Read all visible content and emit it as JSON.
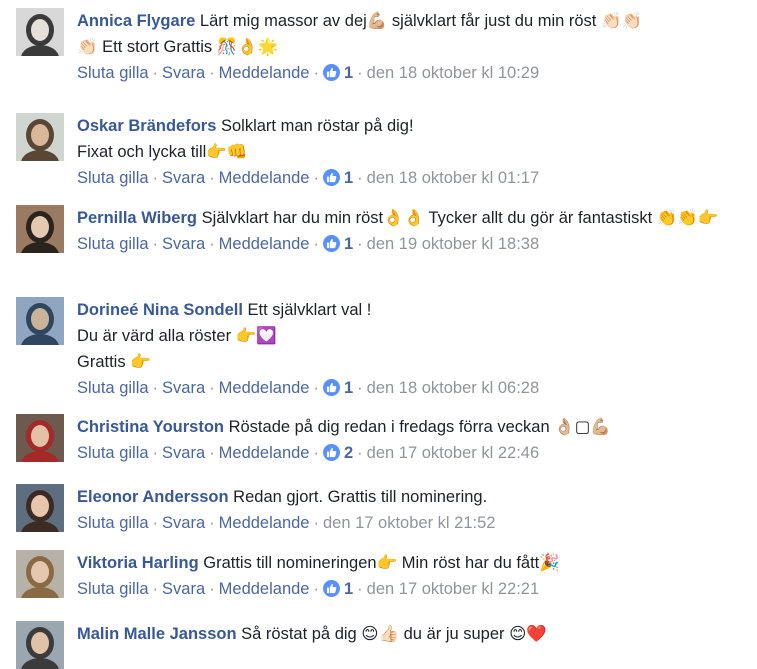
{
  "comments": [
    {
      "author": "Annica Flygare",
      "text": "Lärt mig massor av dej💪🏼 självklart får just du min röst 👏🏻👏🏻\n👏🏻 Ett stort Grattis 🎊👌🌟",
      "actions": {
        "unlike": "Sluta gilla",
        "reply": "Svara",
        "message": "Meddelande"
      },
      "likes": "1",
      "timestamp": "den 18 oktober kl 10:29",
      "avatar_colors": [
        "#d8d8d8",
        "#3a3a3a",
        "#e7e0d8"
      ]
    },
    {
      "author": "Oskar Brändefors",
      "text": "Solklart man röstar på dig!\nFixat och lycka till👉👊",
      "actions": {
        "unlike": "Sluta gilla",
        "reply": "Svara",
        "message": "Meddelande"
      },
      "likes": "1",
      "timestamp": "den 18 oktober kl 01:17",
      "avatar_colors": [
        "#cfd6cf",
        "#5a4634",
        "#d9b79a"
      ]
    },
    {
      "author": "Pernilla Wiberg",
      "text": "Självklart har du min röst👌👌 Tycker allt du gör är fantastiskt 👏👏👉",
      "actions": {
        "unlike": "Sluta gilla",
        "reply": "Svara",
        "message": "Meddelande"
      },
      "likes": "1",
      "timestamp": "den 19 oktober kl 18:38",
      "avatar_colors": [
        "#9a7a62",
        "#2b241e",
        "#e5c8b0"
      ]
    },
    {
      "author": "Dorineé Nina Sondell",
      "text": "Ett självklart val !\nDu är värd alla röster 👉💟\nGrattis 👉",
      "actions": {
        "unlike": "Sluta gilla",
        "reply": "Svara",
        "message": "Meddelande"
      },
      "likes": "1",
      "timestamp": "den 18 oktober kl 06:28",
      "avatar_colors": [
        "#8ea6bf",
        "#2f4660",
        "#c9b49a"
      ]
    },
    {
      "author": "Christina Yourston",
      "text": "Röstade på dig redan i fredags förra veckan 👌🏼▢💪🏼",
      "actions": {
        "unlike": "Sluta gilla",
        "reply": "Svara",
        "message": "Meddelande"
      },
      "likes": "2",
      "timestamp": "den 17 oktober kl 22:46",
      "avatar_colors": [
        "#6d5a4e",
        "#a42a2a",
        "#e2c1a6"
      ]
    },
    {
      "author": "Eleonor Andersson",
      "text": "Redan gjort. Grattis till nominering.",
      "actions": {
        "unlike": "Sluta gilla",
        "reply": "Svara",
        "message": "Meddelande"
      },
      "likes": "",
      "timestamp": "den 17 oktober kl 21:52",
      "avatar_colors": [
        "#5c6e80",
        "#3a2c22",
        "#e8c6ad"
      ]
    },
    {
      "author": "Viktoria Harling",
      "text": "Grattis till nomineringen👉 Min röst har du fått🎉",
      "actions": {
        "unlike": "Sluta gilla",
        "reply": "Svara",
        "message": "Meddelande"
      },
      "likes": "1",
      "timestamp": "den 17 oktober kl 22:21",
      "avatar_colors": [
        "#b7b2a8",
        "#8a6a44",
        "#e4c7ae"
      ]
    },
    {
      "author": "Malin Malle Jansson",
      "text": "Så röstat på dig 😊👍🏻 du är ju super 😊❤️",
      "actions": {
        "unlike": "",
        "reply": "",
        "message": ""
      },
      "likes": "",
      "timestamp": "",
      "avatar_colors": [
        "#9aa6b0",
        "#3b3b3b",
        "#dfc2a8"
      ]
    }
  ],
  "colors": {
    "author": "#385898",
    "action_link": "#4b67a1",
    "meta": "#90949c",
    "like_badge": "#5890ff"
  }
}
